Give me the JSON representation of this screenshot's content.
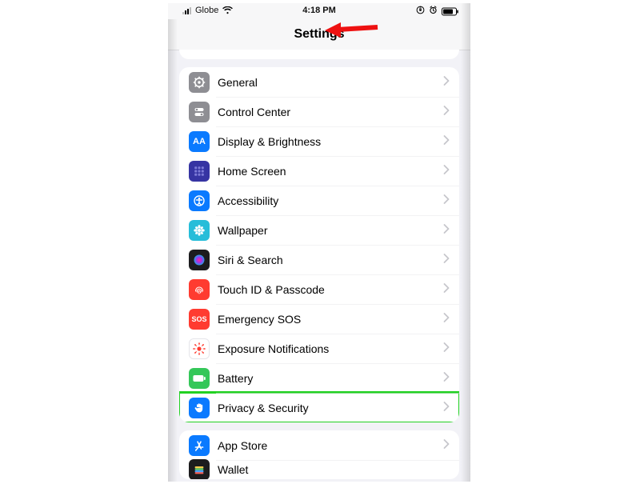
{
  "statusbar": {
    "carrier": "Globe",
    "time": "4:18 PM"
  },
  "navbar": {
    "title": "Settings"
  },
  "group1": [
    {
      "label": "General",
      "icon": "gear"
    },
    {
      "label": "Control Center",
      "icon": "switches"
    },
    {
      "label": "Display & Brightness",
      "icon": "AA"
    },
    {
      "label": "Home Screen",
      "icon": "grid"
    },
    {
      "label": "Accessibility",
      "icon": "person"
    },
    {
      "label": "Wallpaper",
      "icon": "flower"
    },
    {
      "label": "Siri & Search",
      "icon": "siri"
    },
    {
      "label": "Touch ID & Passcode",
      "icon": "fingerprint"
    },
    {
      "label": "Emergency SOS",
      "icon": "SOS"
    },
    {
      "label": "Exposure Notifications",
      "icon": "sun"
    },
    {
      "label": "Battery",
      "icon": "battery"
    },
    {
      "label": "Privacy & Security",
      "icon": "hand",
      "highlight": true
    }
  ],
  "group2": [
    {
      "label": "App Store",
      "icon": "appstore"
    },
    {
      "label": "Wallet",
      "icon": "wallet"
    }
  ]
}
